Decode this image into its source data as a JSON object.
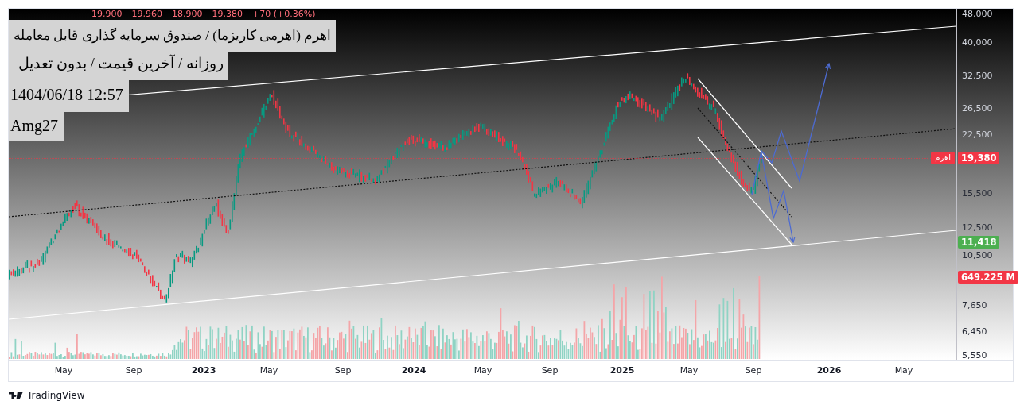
{
  "legend": {
    "values": [
      "19,900",
      "19,960",
      "18,900",
      "19,380",
      "+70 (+0.36%)"
    ]
  },
  "info_boxes": [
    "اهرم (اهرمی کاریزما) / صندوق سرمایه گذاری قابل معامله",
    "روزانه / آخرین قیمت / بدون تعدیل",
    "1404/06/18 12:57",
    "Amg27"
  ],
  "price_axis": {
    "ticks": [
      {
        "label": "48,000",
        "kind": "price"
      },
      {
        "label": "40,000",
        "kind": "price"
      },
      {
        "label": "32,500",
        "kind": "price"
      },
      {
        "label": "26,500",
        "kind": "price"
      },
      {
        "label": "22,500",
        "kind": "price"
      },
      {
        "label": "15,500",
        "kind": "price"
      },
      {
        "label": "12,500",
        "kind": "price"
      },
      {
        "label": "10,500",
        "kind": "price"
      },
      {
        "label": "7,650",
        "kind": "volume"
      },
      {
        "label": "6,450",
        "kind": "volume"
      },
      {
        "label": "5,550",
        "kind": "volume"
      }
    ]
  },
  "price_labels": [
    {
      "kind": "price",
      "symbol": "اهرم",
      "value": "19,380",
      "color": "#f23645"
    },
    {
      "kind": "price",
      "value": "11,418",
      "color": "#4caf50"
    },
    {
      "kind": "volume",
      "value": "649.225 M",
      "color": "#f23645"
    }
  ],
  "time_axis": {
    "ticks": [
      {
        "label": "May",
        "kind": "month"
      },
      {
        "label": "Sep",
        "kind": "month"
      },
      {
        "label": "2023",
        "kind": "year"
      },
      {
        "label": "May",
        "kind": "month"
      },
      {
        "label": "Sep",
        "kind": "month"
      },
      {
        "label": "2024",
        "kind": "year"
      },
      {
        "label": "May",
        "kind": "month"
      },
      {
        "label": "Sep",
        "kind": "month"
      },
      {
        "label": "2025",
        "kind": "year"
      },
      {
        "label": "May",
        "kind": "month"
      },
      {
        "label": "Sep",
        "kind": "month"
      },
      {
        "label": "2026",
        "kind": "year"
      },
      {
        "label": "May",
        "kind": "month"
      }
    ]
  },
  "footer": {
    "brand": "TradingView"
  }
}
